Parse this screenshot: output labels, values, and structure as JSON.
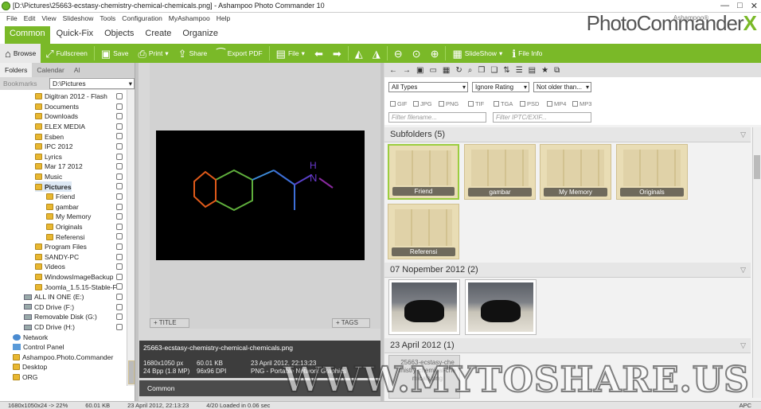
{
  "window": {
    "title": "[D:\\Pictures\\25663-ecstasy-chemistry-chemical-chemicals.png] - Ashampoo Photo Commander 10",
    "controls": [
      "—",
      "□",
      "✕"
    ]
  },
  "menu": [
    "File",
    "Edit",
    "View",
    "Slideshow",
    "Tools",
    "Configuration",
    "MyAshampoo",
    "Help"
  ],
  "ribbon_tabs": [
    "Common",
    "Quick-Fix",
    "Objects",
    "Create",
    "Organize"
  ],
  "logo": {
    "brand": "Ashampoo®",
    "name": "PhotoCommander",
    "mark": "X"
  },
  "toolbar": [
    {
      "label": "Browse",
      "icon": "home-icon",
      "glyph": "⌂"
    },
    {
      "label": "Fullscreen",
      "icon": "fullscreen-icon",
      "glyph": "⤢"
    },
    {
      "label": "Save",
      "icon": "save-icon",
      "glyph": "▣"
    },
    {
      "label": "Print",
      "icon": "print-icon",
      "glyph": "⎙"
    },
    {
      "label": "Share",
      "icon": "share-icon",
      "glyph": "⇪"
    },
    {
      "label": "Export PDF",
      "icon": "pdf-icon",
      "glyph": "⁀"
    },
    {
      "label": "File",
      "icon": "image-icon",
      "glyph": "▤"
    },
    {
      "label": "",
      "icon": "arrow-left-icon",
      "glyph": "⬅"
    },
    {
      "label": "",
      "icon": "arrow-right-icon",
      "glyph": "➡"
    },
    {
      "label": "",
      "icon": "flip-icon",
      "glyph": "◭"
    },
    {
      "label": "",
      "icon": "mirror-icon",
      "glyph": "◮"
    },
    {
      "label": "",
      "icon": "zoom-out-icon",
      "glyph": "⊖"
    },
    {
      "label": "",
      "icon": "zoom-icon",
      "glyph": "⊙"
    },
    {
      "label": "",
      "icon": "zoom-in-icon",
      "glyph": "⊕"
    },
    {
      "label": "SlideShow",
      "icon": "slideshow-icon",
      "glyph": "▦"
    },
    {
      "label": "File Info",
      "icon": "info-icon",
      "glyph": "ℹ"
    }
  ],
  "left": {
    "tabs": [
      "Folders",
      "Calendar",
      "Al"
    ],
    "bookmarks_label": "Bookmarks",
    "path": "D:\\Pictures",
    "tree": [
      "Digitran 2012 - Flash",
      "Documents",
      "Downloads",
      "ELEX MEDIA",
      "Esben",
      "IPC 2012",
      "Lyrics",
      "Mar 17 2012",
      "Music",
      "Pictures",
      "Friend",
      "gambar",
      "My Memory",
      "Originals",
      "Referensi",
      "Program Files",
      "SANDY-PC",
      "Videos",
      "WindowsImageBackup",
      "Joomla_1.5.15-Stable-Fu",
      "ALL IN ONE (E:)",
      "CD Drive (F:)",
      "Removable Disk (G:)",
      "CD Drive (H:)",
      "Network",
      "Control Panel",
      "Ashampoo.Photo.Commander",
      "Desktop",
      "ORG"
    ]
  },
  "preview": {
    "title_tag": "TITLE",
    "tags_tag": "TAGS",
    "filename": "25663-ecstasy-chemistry-chemical-chemicals.png",
    "info": [
      "1680x1050 px",
      "60.01 KB",
      "23 April 2012, 22:13:23",
      "24 Bpp (1.8 MP)",
      "96x96 DPI",
      "PNG - Portable Network Graphics"
    ],
    "common": "Common"
  },
  "filters": {
    "type": "All Types",
    "rating": "Ignore Rating",
    "age": "Not older than...",
    "formats": [
      "GIF",
      "JPG",
      "PNG",
      "TIF",
      "TGA",
      "PSD",
      "MP4",
      "MP3"
    ],
    "filename_placeholder": "Filter filename...",
    "iptc_placeholder": "Filter IPTC/EXIF..."
  },
  "sections": [
    {
      "title": "Subfolders (5)"
    },
    {
      "title": "07 Nopember 2012 (2)"
    },
    {
      "title": "23 April 2012 (1)"
    }
  ],
  "subfolders": [
    "Friend",
    "gambar",
    "My Memory",
    "Originals",
    "Referensi"
  ],
  "april_file": "25663-ecstasy-chemistry-chemical-chemicals.png",
  "status": [
    "1680x1050x24 -> 22%",
    "60.01 KB",
    "23 April 2012, 22:13:23",
    "4/20  Loaded in 0.06 sec",
    "APC"
  ],
  "watermark": "WWW.MYTOSHARE.US",
  "colors": {
    "accent": "#7ab928"
  }
}
